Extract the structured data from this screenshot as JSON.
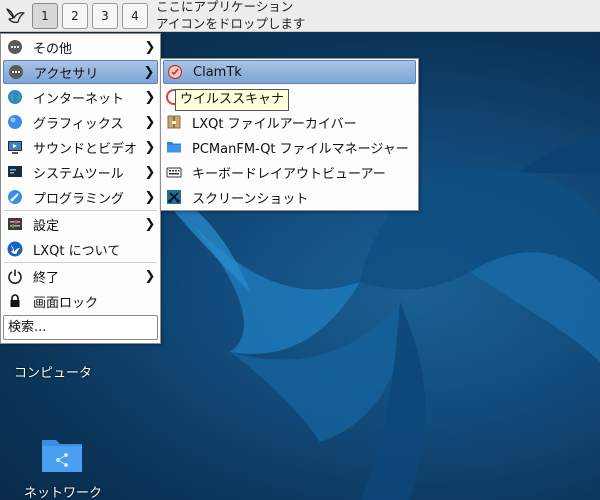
{
  "panel": {
    "desktops": [
      "1",
      "2",
      "3",
      "4"
    ],
    "active_desktop": "1",
    "quicklaunch_hint_line1": "ここにアプリケーション",
    "quicklaunch_hint_line2": "アイコンをドロップします"
  },
  "main_menu": {
    "items": [
      {
        "label": "その他",
        "icon": "ellipsis-icon",
        "submenu": true
      },
      {
        "label": "アクセサリ",
        "icon": "ellipsis-icon",
        "submenu": true,
        "highlighted": true
      },
      {
        "label": "インターネット",
        "icon": "globe-icon",
        "submenu": true
      },
      {
        "label": "グラフィックス",
        "icon": "graphics-icon",
        "submenu": true
      },
      {
        "label": "サウンドとビデオ",
        "icon": "multimedia-icon",
        "submenu": true
      },
      {
        "label": "システムツール",
        "icon": "system-tools-icon",
        "submenu": true
      },
      {
        "label": "プログラミング",
        "icon": "programming-icon",
        "submenu": true
      },
      {
        "label": "設定",
        "icon": "settings-icon",
        "submenu": true
      },
      {
        "label": "LXQt について",
        "icon": "lxqt-logo-icon",
        "submenu": false
      },
      {
        "label": "終了",
        "icon": "power-icon",
        "submenu": true
      },
      {
        "label": "画面ロック",
        "icon": "lock-icon",
        "submenu": false
      }
    ],
    "search_text": "検索..."
  },
  "accessories_submenu": {
    "items": [
      {
        "label": "ClamTk",
        "icon": "clamtk-icon",
        "highlighted": true
      },
      {
        "label": "",
        "icon": "galculator-icon"
      },
      {
        "label": "LXQt ファイルアーカイバー",
        "icon": "archiver-icon"
      },
      {
        "label": "PCManFM-Qt ファイルマネージャー",
        "icon": "folder-icon"
      },
      {
        "label": "キーボードレイアウトビューアー",
        "icon": "keyboard-icon"
      },
      {
        "label": "スクリーンショット",
        "icon": "screenshot-icon"
      }
    ]
  },
  "tooltip": "ウイルススキャナ",
  "desktop_icons": {
    "computer_label": "コンピュータ",
    "network_label": "ネットワーク"
  },
  "colors": {
    "highlight": "#7ea4d4",
    "wallpaper": "#124b7c"
  }
}
